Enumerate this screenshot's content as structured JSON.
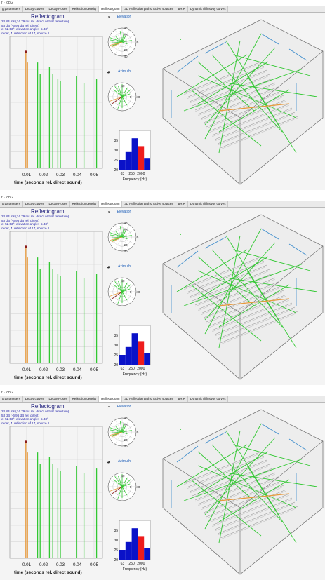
{
  "window": {
    "title": "r - job 2"
  },
  "tabs": [
    {
      "label": "g parameters",
      "active": false
    },
    {
      "label": "Decay curves",
      "active": false
    },
    {
      "label": "Decay Roses",
      "active": false
    },
    {
      "label": "Reflection density",
      "active": false
    },
    {
      "label": "Reflectogram",
      "active": true
    },
    {
      "label": "3D Reflection paths/ Active sources",
      "active": false
    },
    {
      "label": "BRIR",
      "active": false
    },
    {
      "label": "Dynamic diffusivity curves",
      "active": false
    }
  ],
  "reflectogram": {
    "title": "Reflectogram",
    "info_lines": [
      "28.83 ms (14.79 ms rel. direct or first reflection)",
      "53 dB (-6.96 dB rel. direct)",
      "e: 52.53°, elevation angle: -5.33°",
      "order, 4, reflection of 17, source 1"
    ],
    "x_ticks": [
      "0.01",
      "0.02",
      "0.03",
      "0.04",
      "0.05"
    ],
    "xlabel": "time (seconds rel. direct sound)"
  },
  "elevation": {
    "title": "Elevation",
    "ticks": [
      "40",
      "20",
      "0",
      "20",
      "40"
    ]
  },
  "azimuth": {
    "title": "Azimuth",
    "ticks": [
      "40",
      "0",
      "40"
    ]
  },
  "histogram": {
    "xlabel": "Frequency (Hz)",
    "y_ticks": [
      "35",
      "30",
      "25",
      "20"
    ],
    "x_ticks": [
      "63",
      "250",
      "2000"
    ]
  },
  "chart_data": {
    "type": "bar",
    "x": [
      0.0095,
      0.0105,
      0.0165,
      0.018,
      0.0235,
      0.0255,
      0.0285,
      0.03,
      0.0395,
      0.044,
      0.0515
    ],
    "values": [
      1.0,
      0.92,
      0.92,
      0.82,
      0.88,
      0.82,
      0.78,
      0.76,
      0.8,
      0.74,
      0.78
    ],
    "colors": [
      "#e89a3c",
      "#e89a3c",
      "#32c832",
      "#32c832",
      "#32c832",
      "#32c832",
      "#32c832",
      "#32c832",
      "#32c832",
      "#32c832",
      "#32c832"
    ],
    "xlim": [
      0.0,
      0.055
    ],
    "marker_at": 0.0095,
    "grid": true
  },
  "hist_data": {
    "values": [
      25,
      29,
      36,
      32,
      26
    ],
    "colors": [
      "#0a12c8",
      "#0a12c8",
      "#0a12c8",
      "#ee1c1c",
      "#0a12c8"
    ],
    "ylim": [
      20,
      40
    ]
  },
  "colors": {
    "green": "#32c832",
    "orange": "#e89a3c",
    "blue": "#0a12c8",
    "red": "#ee1c1c",
    "accent": "#1a5cb8"
  }
}
